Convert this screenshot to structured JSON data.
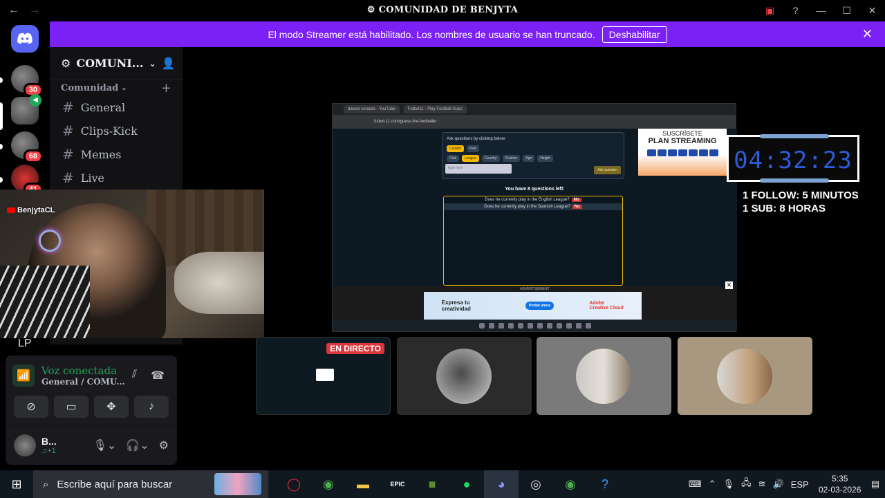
{
  "window": {
    "title": "COMUNIDAD DE BENJYTA",
    "back": "←",
    "forward": "→"
  },
  "banner": {
    "message": "El modo Streamer está habilitado. Los nombres de usuario se han truncado.",
    "button": "Deshabilitar"
  },
  "servers": [
    {
      "badge": "30"
    },
    {
      "badge": ""
    },
    {
      "badge": "68"
    },
    {
      "badge": "41"
    }
  ],
  "sidebar": {
    "server_name": "COMUNI...",
    "category": "Comunidad",
    "channels": [
      "General",
      "Clips-Kick",
      "Memes",
      "Live"
    ]
  },
  "webcam": {
    "tag": "BenjytaCL"
  },
  "lp_label": "LP",
  "voice": {
    "status": "Voz conectada",
    "channel": "General / COMU..."
  },
  "user": {
    "name": "B...",
    "status": "♫+1"
  },
  "stream": {
    "tab1": "dawoo senaize - YouTube",
    "tab2": "Futbol11 - Play Football Gues",
    "url": "futbol-11.com/guess-the-footballer",
    "prompt": "Ask questions by clicking below:",
    "chips_row1": [
      "Current",
      "Past"
    ],
    "chips_row2": [
      "Club",
      "League",
      "Country",
      "Position",
      "Age",
      "Height"
    ],
    "input_placeholder": "Type here",
    "ask": "Ask question",
    "questions_left": "You have 8 questions left:",
    "answers": [
      {
        "q": "Does he currently play in the English League?",
        "a": "No"
      },
      {
        "q": "Does he currently play in the Spanish League?",
        "a": "No"
      }
    ],
    "subscribe_a": "SUSCRÍBETE",
    "subscribe_b": "PLAN STREAMING",
    "ad_label": "ADVERTISEMENT",
    "ad_text": "Expresa tu creatividad",
    "ad_btn": "Probar ahora",
    "ad_brand": "Adobe Creative Cloud"
  },
  "timer": "04:32:23",
  "follow": {
    "line1": "1 FOLLOW: 5 MINUTOS",
    "line2": "1 SUB: 8 HORAS"
  },
  "tiles": {
    "live": "EN DIRECTO"
  },
  "taskbar": {
    "search": "Escribe aquí para buscar",
    "lang": "ESP",
    "time": "5:35",
    "date": "02-03-2026"
  },
  "colors": {
    "banner": "#7b21f5",
    "accent_green": "#23a55a",
    "live_red": "#da373c",
    "timer_blue": "#2d5bd7"
  }
}
